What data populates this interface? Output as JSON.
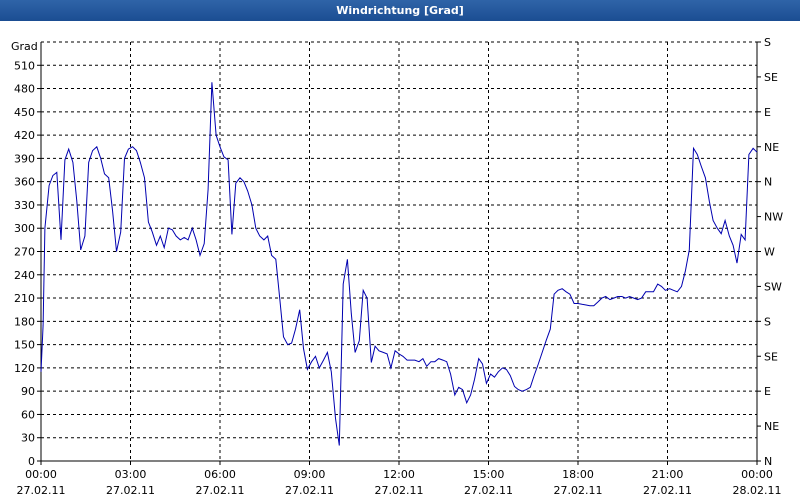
{
  "window": {
    "title": "Windrichtung [Grad]"
  },
  "chart_data": {
    "type": "line",
    "title": "Windrichtung [Grad]",
    "ylabel": "Grad",
    "ylim": [
      0,
      540
    ],
    "yticks": [
      0,
      30,
      60,
      90,
      120,
      150,
      180,
      210,
      240,
      270,
      300,
      330,
      360,
      390,
      420,
      450,
      480,
      510
    ],
    "y2ticks": [
      {
        "value": 0,
        "label": "N"
      },
      {
        "value": 45,
        "label": "NE"
      },
      {
        "value": 90,
        "label": "E"
      },
      {
        "value": 135,
        "label": "SE"
      },
      {
        "value": 180,
        "label": "S"
      },
      {
        "value": 225,
        "label": "SW"
      },
      {
        "value": 270,
        "label": "W"
      },
      {
        "value": 315,
        "label": "NW"
      },
      {
        "value": 360,
        "label": "N"
      },
      {
        "value": 405,
        "label": "NE"
      },
      {
        "value": 450,
        "label": "E"
      },
      {
        "value": 495,
        "label": "SE"
      },
      {
        "value": 540,
        "label": "S"
      }
    ],
    "xlim": [
      0,
      24
    ],
    "xticks": [
      {
        "value": 0,
        "time": "00:00",
        "date": "27.02.11"
      },
      {
        "value": 3,
        "time": "03:00",
        "date": "27.02.11"
      },
      {
        "value": 6,
        "time": "06:00",
        "date": "27.02.11"
      },
      {
        "value": 9,
        "time": "09:00",
        "date": "27.02.11"
      },
      {
        "value": 12,
        "time": "12:00",
        "date": "27.02.11"
      },
      {
        "value": 15,
        "time": "15:00",
        "date": "27.02.11"
      },
      {
        "value": 18,
        "time": "18:00",
        "date": "27.02.11"
      },
      {
        "value": 21,
        "time": "21:00",
        "date": "27.02.11"
      },
      {
        "value": 24,
        "time": "00:00",
        "date": "28.02.11"
      }
    ],
    "grid": true,
    "line_color": "#0000b0",
    "series": [
      {
        "x": [
          0.0,
          0.07,
          0.13,
          0.27,
          0.4,
          0.53,
          0.67,
          0.8,
          0.93,
          1.07,
          1.2,
          1.33,
          1.47,
          1.6,
          1.73,
          1.87,
          2.0,
          2.13,
          2.27,
          2.4,
          2.53,
          2.67,
          2.8,
          2.93,
          3.07,
          3.2,
          3.33,
          3.47,
          3.6,
          3.73,
          3.87,
          4.0,
          4.13,
          4.27,
          4.4,
          4.53,
          4.67,
          4.8,
          4.93,
          5.07,
          5.2,
          5.33,
          5.47,
          5.6,
          5.73,
          5.87,
          6.0,
          6.13,
          6.27,
          6.4,
          6.53,
          6.67,
          6.8,
          6.93,
          7.07,
          7.2,
          7.33,
          7.47,
          7.6,
          7.73,
          7.87,
          8.0,
          8.13,
          8.27,
          8.4,
          8.53,
          8.67,
          8.8,
          8.93,
          9.07,
          9.2,
          9.33,
          9.47,
          9.6,
          9.73,
          9.87,
          10.0,
          10.13,
          10.27,
          10.4,
          10.53,
          10.67,
          10.8,
          10.93,
          11.07,
          11.2,
          11.33,
          11.47,
          11.6,
          11.73,
          11.87,
          12.0,
          12.13,
          12.27,
          12.4,
          12.53,
          12.67,
          12.8,
          12.93,
          13.07,
          13.2,
          13.33,
          13.47,
          13.6,
          13.73,
          13.87,
          14.0,
          14.13,
          14.27,
          14.4,
          14.53,
          14.67,
          14.8,
          14.93,
          15.07,
          15.2,
          15.33,
          15.47,
          15.6,
          15.73,
          15.87,
          16.0,
          16.13,
          16.27,
          16.4,
          16.53,
          16.67,
          16.8,
          16.93,
          17.07,
          17.2,
          17.33,
          17.47,
          17.6,
          17.73,
          17.87,
          18.0,
          18.13,
          18.27,
          18.4,
          18.53,
          18.67,
          18.8,
          18.93,
          19.07,
          19.2,
          19.33,
          19.47,
          19.6,
          19.73,
          19.87,
          20.0,
          20.13,
          20.27,
          20.4,
          20.53,
          20.67,
          20.8,
          20.93,
          21.07,
          21.2,
          21.33,
          21.47,
          21.6,
          21.73,
          21.87,
          22.0,
          22.13,
          22.27,
          22.4,
          22.53,
          22.67,
          22.8,
          22.93,
          23.07,
          23.2,
          23.33,
          23.47,
          23.6,
          23.73,
          23.87,
          24.0
        ],
        "values": [
          115,
          175,
          300,
          355,
          368,
          372,
          285,
          388,
          402,
          385,
          335,
          272,
          290,
          385,
          400,
          405,
          390,
          370,
          365,
          322,
          270,
          295,
          390,
          402,
          405,
          400,
          385,
          365,
          308,
          295,
          278,
          290,
          275,
          300,
          298,
          290,
          285,
          288,
          285,
          300,
          285,
          265,
          280,
          350,
          488,
          420,
          405,
          392,
          388,
          292,
          358,
          365,
          360,
          348,
          330,
          300,
          290,
          285,
          290,
          265,
          260,
          210,
          160,
          150,
          152,
          170,
          195,
          145,
          118,
          128,
          135,
          120,
          130,
          140,
          115,
          55,
          20,
          228,
          260,
          190,
          140,
          155,
          220,
          210,
          127,
          148,
          142,
          140,
          138,
          120,
          142,
          138,
          135,
          130,
          130,
          130,
          128,
          132,
          122,
          128,
          128,
          132,
          130,
          128,
          112,
          85,
          95,
          92,
          75,
          85,
          105,
          132,
          125,
          100,
          112,
          108,
          115,
          120,
          118,
          110,
          96,
          92,
          90,
          92,
          95,
          110,
          125,
          140,
          155,
          170,
          215,
          220,
          222,
          218,
          215,
          203,
          203,
          202,
          201,
          200,
          200,
          205,
          210,
          212,
          208,
          210,
          212,
          212,
          210,
          212,
          210,
          208,
          210,
          218,
          218,
          218,
          228,
          225,
          220,
          222,
          220,
          218,
          225,
          245,
          272,
          403,
          395,
          380,
          365,
          335,
          310,
          300,
          293,
          310,
          290,
          278,
          255,
          292,
          285,
          395,
          403,
          398
        ]
      }
    ]
  }
}
